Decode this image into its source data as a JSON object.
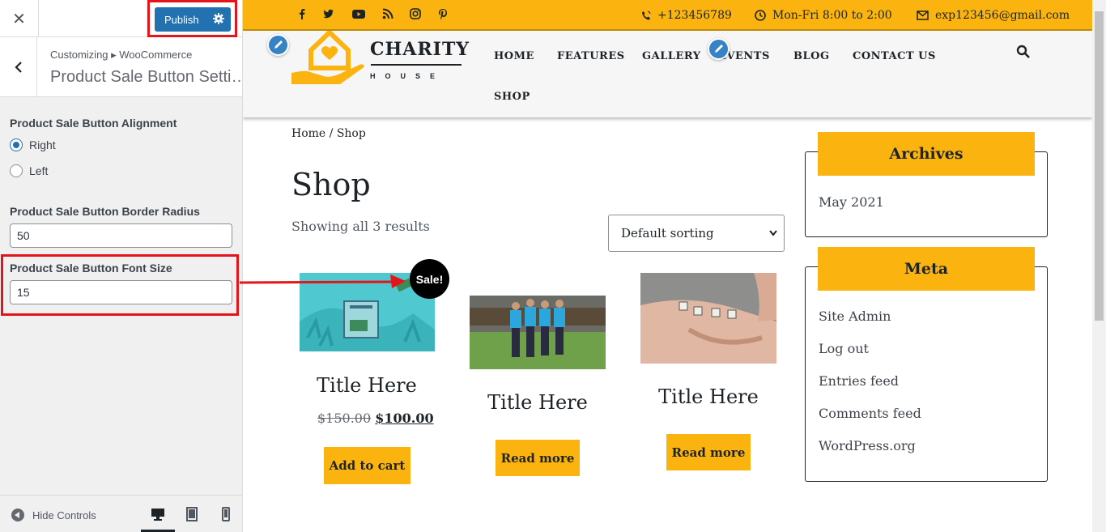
{
  "customizer": {
    "close_icon": "close-icon",
    "publish_label": "Publish",
    "breadcrumb": "Customizing ▸ WooCommerce",
    "section_title": "Product Sale Button Setti…",
    "alignment_label": "Product Sale Button Alignment",
    "alignment_options": [
      {
        "label": "Right",
        "selected": true
      },
      {
        "label": "Left",
        "selected": false
      }
    ],
    "radius_label": "Product Sale Button Border Radius",
    "radius_value": "50",
    "font_size_label": "Product Sale Button Font Size",
    "font_size_value": "15",
    "hide_controls": "Hide Controls",
    "preview_device_selected": "desktop"
  },
  "site": {
    "phone": "+123456789",
    "hours": "Mon-Fri 8:00 to 2:00",
    "email": "exp123456@gmail.com",
    "social_icons": [
      "facebook-icon",
      "twitter-icon",
      "youtube-icon",
      "rss-icon",
      "instagram-icon",
      "pinterest-icon"
    ],
    "logo_main": "CHARITY",
    "logo_sub": "HOUSE",
    "nav": [
      "HOME",
      "FEATURES",
      "GALLERY",
      "EVENTS",
      "BLOG",
      "CONTACT US",
      "SHOP"
    ],
    "breadcrumb": "Home / Shop",
    "page_title": "Shop",
    "result_count": "Showing all 3 results",
    "sort_value": "Default sorting",
    "sale_badge": "Sale!",
    "products": [
      {
        "title": "Title Here",
        "old_price": "$150.00",
        "price": "$100.00",
        "button": "Add to cart"
      },
      {
        "title": "Title Here",
        "button": "Read more"
      },
      {
        "title": "Title Here",
        "button": "Read more"
      }
    ],
    "widgets": {
      "archives_title": "Archives",
      "archives_items": [
        "May 2021"
      ],
      "meta_title": "Meta",
      "meta_items": [
        "Site Admin",
        "Log out",
        "Entries feed",
        "Comments feed",
        "WordPress.org"
      ]
    },
    "colors": {
      "accent": "#fbb40f",
      "publish": "#2271b1",
      "highlight": "#e3151a"
    }
  }
}
